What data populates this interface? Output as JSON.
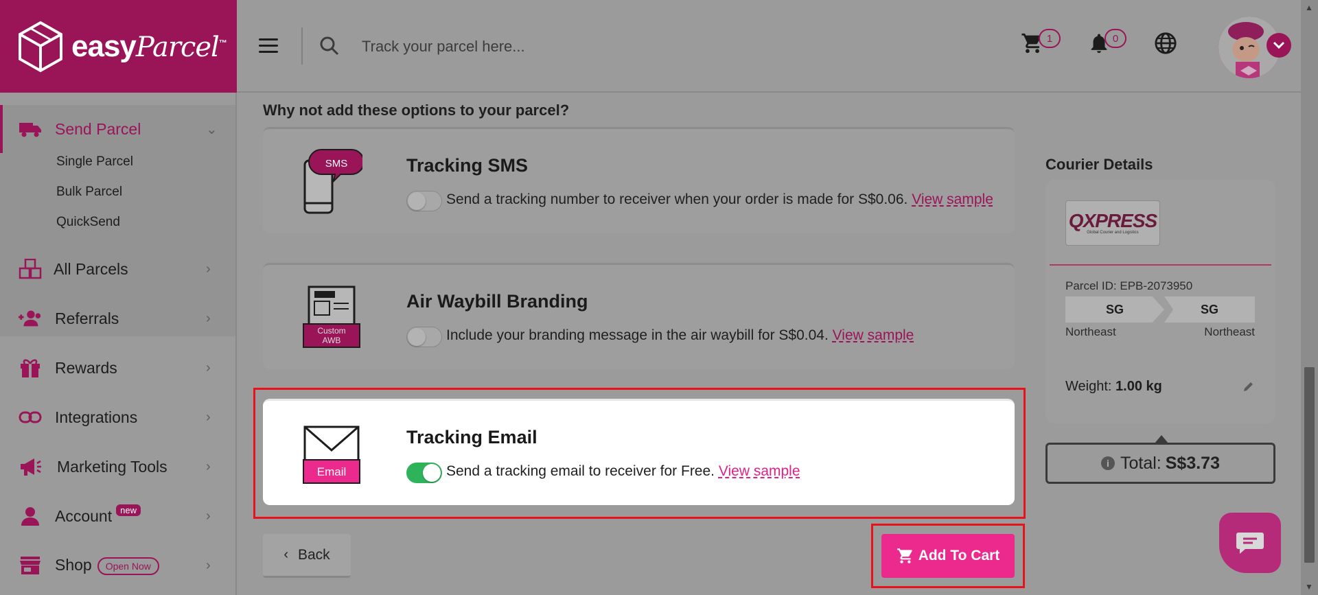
{
  "brand": {
    "name_bold": "easy",
    "name_script": "Parcel",
    "tm": "™"
  },
  "topbar": {
    "search": {
      "placeholder": "Track your parcel here..."
    },
    "cart_count": "1",
    "notification_count": "0"
  },
  "sidebar": {
    "send_parcel": {
      "label": "Send Parcel",
      "subitems": [
        "Single Parcel",
        "Bulk Parcel",
        "QuickSend"
      ]
    },
    "items": [
      {
        "label": "All Parcels",
        "icon": "boxes-icon"
      },
      {
        "label": "Referrals",
        "icon": "users-plus-icon"
      },
      {
        "label": "Rewards",
        "icon": "gift-icon"
      },
      {
        "label": "Integrations",
        "icon": "link-icon"
      },
      {
        "label": "Marketing Tools",
        "icon": "megaphone-icon"
      },
      {
        "label": "Account",
        "icon": "user-icon",
        "badge": "new"
      },
      {
        "label": "Shop",
        "icon": "store-icon",
        "badge": "Open Now"
      }
    ]
  },
  "main": {
    "section_title": "Why not add these options to your parcel?",
    "addons": [
      {
        "title": "Tracking SMS",
        "art_label": "SMS",
        "enabled": false,
        "desc": "Send a tracking number to receiver when your order is made for S$0.06.",
        "link": "View sample"
      },
      {
        "title": "Air Waybill Branding",
        "art_label_1": "Custom",
        "art_label_2": "AWB",
        "enabled": false,
        "desc": "Include your branding message in the air waybill for S$0.04.",
        "link": "View sample"
      },
      {
        "title": "Tracking Email",
        "art_label": "Email",
        "enabled": true,
        "desc": "Send a tracking email to receiver for Free.",
        "link": "View sample"
      }
    ],
    "back_label": "Back",
    "add_to_cart_label": "Add To Cart"
  },
  "courier": {
    "title": "Courier Details",
    "logo_text": "QXPRESS",
    "logo_sub": "Global Courier and Logistics",
    "parcel_id": "Parcel ID: EPB-2073950",
    "from_country": "SG",
    "to_country": "SG",
    "from_region": "Northeast",
    "to_region": "Northeast",
    "weight_label": "Weight:",
    "weight_value": "1.00 kg",
    "total_label": "Total:",
    "total_value": "S$3.73"
  },
  "colors": {
    "brand": "#9a1458",
    "accent_pink": "#ec2a8e",
    "toggle_on": "#2fb35a",
    "highlight": "#e8121c"
  }
}
